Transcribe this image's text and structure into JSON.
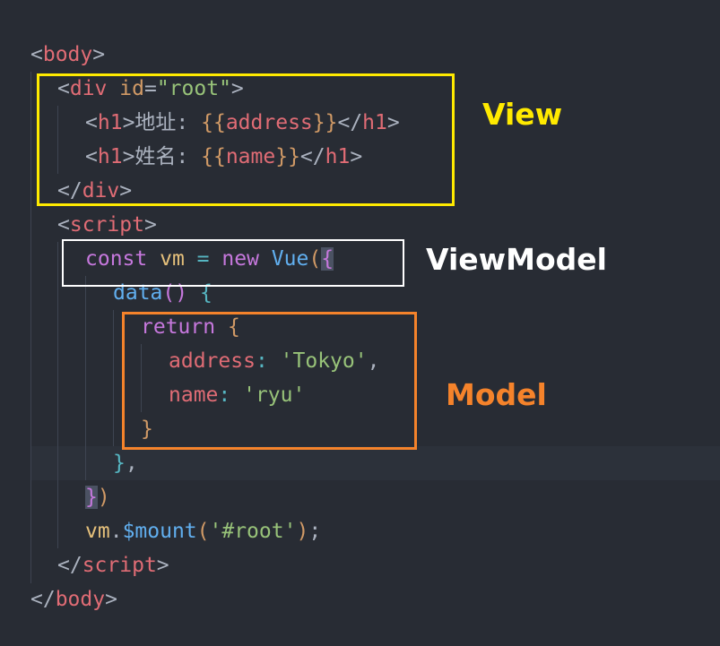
{
  "code": {
    "l1": {
      "open": "<",
      "tag": "body",
      "close": ">"
    },
    "l2": {
      "open": "<",
      "tag": "div",
      "attr": "id",
      "eq": "=",
      "val": "\"root\"",
      "close": ">"
    },
    "l3": {
      "open": "<",
      "tag": "h1",
      "close": ">",
      "text": "地址: ",
      "mopen": "{{",
      "var": "address",
      "mclose": "}}",
      "copen": "</",
      "ctag": "h1",
      "cclose": ">"
    },
    "l4": {
      "open": "<",
      "tag": "h1",
      "close": ">",
      "text": "姓名: ",
      "mopen": "{{",
      "var": "name",
      "mclose": "}}",
      "copen": "</",
      "ctag": "h1",
      "cclose": ">"
    },
    "l5": {
      "open": "</",
      "tag": "div",
      "close": ">"
    },
    "l6": {
      "open": "<",
      "tag": "script",
      "close": ">"
    },
    "l7": {
      "kw": "const",
      "name": "vm",
      "op": "=",
      "kw2": "new",
      "cls": "Vue",
      "paren": "(",
      "brace": "{"
    },
    "l8": {
      "fn": "data",
      "paren": "()",
      "brace": "{"
    },
    "l9": {
      "kw": "return",
      "brace": "{"
    },
    "l10": {
      "key": "address",
      "colon": ":",
      "val": "'Tokyo'",
      "comma": ","
    },
    "l11": {
      "key": "name",
      "colon": ":",
      "val": "'ryu'"
    },
    "l12": {
      "brace": "}"
    },
    "l13": {
      "brace": "}",
      "comma": ","
    },
    "l14": {
      "brace": "}",
      "paren": ")"
    },
    "l15": {
      "obj": "vm",
      "dot": ".",
      "fn": "$mount",
      "paren": "(",
      "str": "'#root'",
      "cparen": ")",
      "semi": ";"
    },
    "l16": {
      "open": "</",
      "tag": "script",
      "close": ">"
    },
    "l17": {
      "open": "</",
      "tag": "body",
      "close": ">"
    }
  },
  "labels": {
    "view": "View",
    "viewmodel": "ViewModel",
    "model": "Model"
  },
  "colors": {
    "background": "#282c34",
    "view_box": "#ffea00",
    "viewmodel_box": "#ffffff",
    "model_box": "#f5832b"
  }
}
